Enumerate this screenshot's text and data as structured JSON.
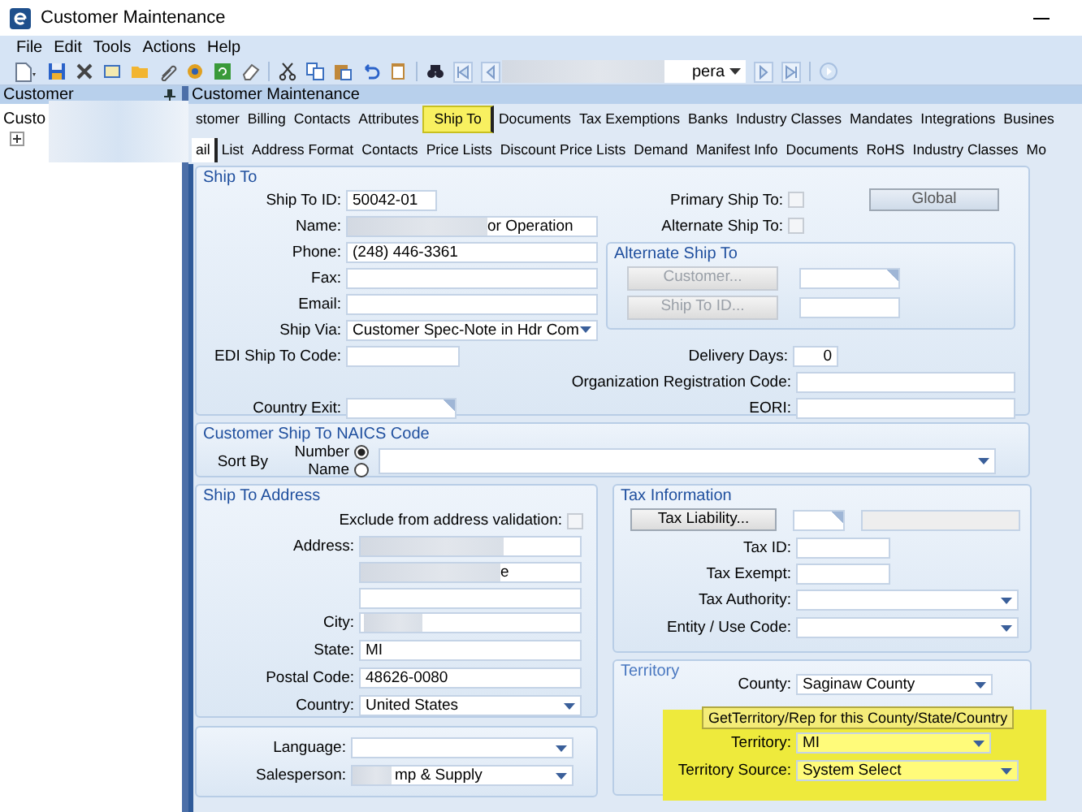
{
  "window": {
    "title": "Customer Maintenance"
  },
  "menu": [
    "File",
    "Edit",
    "Tools",
    "Actions",
    "Help"
  ],
  "toolbar": {
    "record_value": "pera"
  },
  "sidebar": {
    "title": "Customer",
    "tree": [
      {
        "label": "Custo",
        "expanded": false
      }
    ]
  },
  "main_title": "Customer Maintenance",
  "tabs": [
    {
      "label": "stomer",
      "selected": false
    },
    {
      "label": "Billing",
      "selected": false
    },
    {
      "label": "Contacts",
      "selected": false
    },
    {
      "label": "Attributes",
      "selected": false
    },
    {
      "label": "Ship To",
      "selected": true
    },
    {
      "label": "Documents",
      "selected": false
    },
    {
      "label": "Tax Exemptions",
      "selected": false
    },
    {
      "label": "Banks",
      "selected": false
    },
    {
      "label": "Industry Classes",
      "selected": false
    },
    {
      "label": "Mandates",
      "selected": false
    },
    {
      "label": "Integrations",
      "selected": false
    },
    {
      "label": "Busines",
      "selected": false
    }
  ],
  "subtabs": [
    {
      "label": "ail",
      "selected": true
    },
    {
      "label": "List",
      "selected": false
    },
    {
      "label": "Address Format",
      "selected": false
    },
    {
      "label": "Contacts",
      "selected": false
    },
    {
      "label": "Price Lists",
      "selected": false
    },
    {
      "label": "Discount Price Lists",
      "selected": false
    },
    {
      "label": "Demand",
      "selected": false
    },
    {
      "label": "Manifest Info",
      "selected": false
    },
    {
      "label": "Documents",
      "selected": false
    },
    {
      "label": "RoHS",
      "selected": false
    },
    {
      "label": "Industry Classes",
      "selected": false
    },
    {
      "label": "Mo",
      "selected": false
    }
  ],
  "ship_to": {
    "title": "Ship To",
    "ship_to_id": {
      "label": "Ship To ID:",
      "value": "50042-01"
    },
    "name": {
      "label": "Name:",
      "value": "or Operation"
    },
    "phone": {
      "label": "Phone:",
      "value": "(248) 446-3361"
    },
    "fax": {
      "label": "Fax:"
    },
    "email": {
      "label": "Email:"
    },
    "ship_via": {
      "label": "Ship Via:",
      "value": "Customer Spec-Note in Hdr Com"
    },
    "edi_code": {
      "label": "EDI Ship To Code:"
    },
    "country_exit": {
      "label": "Country Exit:"
    },
    "primary": {
      "label": "Primary Ship To:",
      "checked": false
    },
    "alternate": {
      "label": "Alternate Ship To:",
      "checked": false
    },
    "global_button": "Global",
    "alternate_group": {
      "title": "Alternate Ship To",
      "customer_button": {
        "label": "Customer...",
        "disabled": true
      },
      "ship_to_id_button": {
        "label": "Ship To ID...",
        "disabled": true
      }
    },
    "delivery_days": {
      "label": "Delivery Days:",
      "value": "0"
    },
    "org_code": {
      "label": "Organization Registration Code:"
    },
    "eori": {
      "label": "EORI:"
    }
  },
  "naics": {
    "title": "Customer Ship To NAICS Code",
    "sort_label": "Sort By",
    "options": [
      {
        "label": "Number",
        "selected": true
      },
      {
        "label": "Name",
        "selected": false
      }
    ]
  },
  "address": {
    "title": "Ship To Address",
    "exclude": {
      "label": "Exclude from address validation:",
      "checked": false
    },
    "address_label": "Address:",
    "address_line_2": "e",
    "city": {
      "label": "City:"
    },
    "state": {
      "label": "State:",
      "value": "MI"
    },
    "postal": {
      "label": "Postal Code:",
      "value": "48626-0080"
    },
    "country": {
      "label": "Country:",
      "value": "United States"
    }
  },
  "sales": {
    "language": {
      "label": "Language:"
    },
    "salesperson": {
      "label": "Salesperson:",
      "value": "mp & Supply"
    }
  },
  "tax": {
    "title": "Tax Information",
    "liability_button": "Tax Liability...",
    "tax_id": {
      "label": "Tax ID:"
    },
    "tax_exempt": {
      "label": "Tax Exempt:"
    },
    "authority": {
      "label": "Tax Authority:"
    },
    "entity": {
      "label": "Entity / Use Code:"
    }
  },
  "territory": {
    "title": "Territory",
    "county": {
      "label": "County:",
      "value": "Saginaw County"
    },
    "get_button": "GetTerritory/Rep for this County/State/Country",
    "territory": {
      "label": "Territory:",
      "value": "MI"
    },
    "source": {
      "label": "Territory Source:",
      "value": "System Select"
    }
  }
}
